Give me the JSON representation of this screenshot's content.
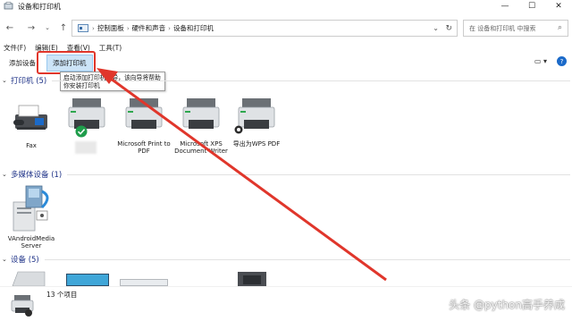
{
  "window": {
    "title": "设备和打印机",
    "controls": {
      "minimize": "—",
      "maximize": "☐",
      "close": "✕"
    }
  },
  "nav": {
    "back": "←",
    "forward": "→",
    "dropdown": "⌄",
    "up": "↑"
  },
  "address": {
    "crumbs": [
      "控制面板",
      "硬件和声音",
      "设备和打印机"
    ],
    "separator": "›",
    "dropdown": "⌄",
    "refresh": "↻"
  },
  "search": {
    "placeholder": "在 设备和打印机 中搜索"
  },
  "menu": [
    "文件(F)",
    "编辑(E)",
    "查看(V)",
    "工具(T)"
  ],
  "toolbar": {
    "add_device": "添加设备",
    "add_printer": "添加打印机"
  },
  "tooltip": {
    "line1": "启动添加打印机向导，该向导将帮助",
    "line2": "你安装打印机"
  },
  "sections": {
    "printers": "打印机 (5)",
    "media": "多媒体设备 (1)",
    "devices": "设备 (5)"
  },
  "printers": [
    {
      "label": "Fax"
    },
    {
      "label": "",
      "default": true
    },
    {
      "label": "Microsoft Print to PDF"
    },
    {
      "label": "Microsoft XPS Document Writer"
    },
    {
      "label": "导出为WPS PDF"
    }
  ],
  "media_devices": [
    {
      "label": "VAndroidMedia Server"
    }
  ],
  "status": {
    "count": "13 个项目"
  },
  "watermark": "头条 @python高手养成",
  "colors": {
    "accent": "#1b6ac9",
    "highlight": "#e0362b",
    "section_text": "#1e3287"
  }
}
